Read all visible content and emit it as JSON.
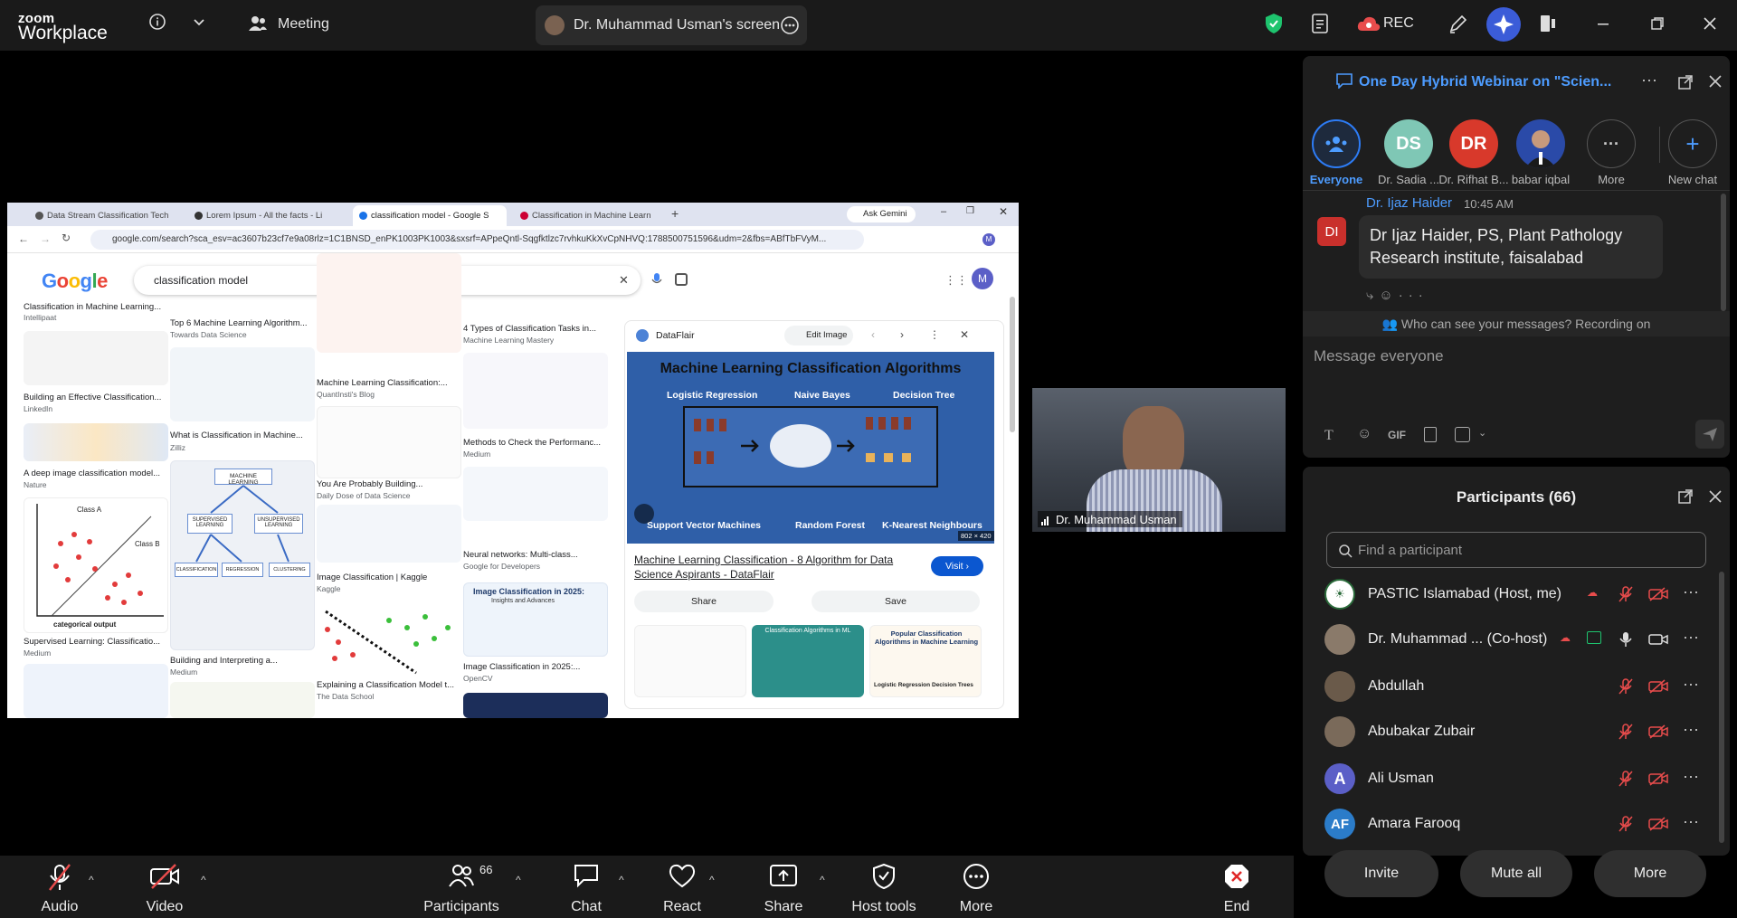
{
  "topbar": {
    "logo_line1": "zoom",
    "logo_line2": "Workplace",
    "meeting_label": "Meeting",
    "screen_label": "Dr. Muhammad Usman's screen",
    "rec_label": "REC"
  },
  "browser": {
    "tabs": [
      {
        "label": "Data Stream Classification Tech"
      },
      {
        "label": "Lorem Ipsum - All the facts - Li"
      },
      {
        "label": "classification model - Google S"
      },
      {
        "label": "Classification in Machine Learn"
      }
    ],
    "ask_gemini": "Ask Gemini",
    "url": "google.com/search?sca_esv=ac3607b23cf7e9a08rlz=1C1BNSD_enPK1003PK1003&sxsrf=APpeQntl-Sqgfktlzc7rvhkuKkXvCpNHVQ:1788500751596&udm=2&fbs=ABfTbFVyM...",
    "search_logo": "Google",
    "search_query": "classification model",
    "avatar_letter": "M",
    "results": [
      {
        "caption": "Classification in Machine Learning...",
        "source": "Intellipaat"
      },
      {
        "caption": "Building an Effective Classification...",
        "source": "LinkedIn"
      },
      {
        "caption": "A deep image classification model...",
        "source": "Nature"
      },
      {
        "caption": "Supervised Learning: Classificatio...",
        "source": "Medium"
      },
      {
        "caption": "Top 6 Machine Learning Algorithm...",
        "source": "Towards Data Science"
      },
      {
        "caption": "What is Classification in Machine...",
        "source": "Zilliz"
      },
      {
        "caption": "Building and Interpreting a...",
        "source": "Medium"
      },
      {
        "caption": "Machine Learning Classification:...",
        "source": "QuantInsti's Blog"
      },
      {
        "caption": "You Are Probably Building...",
        "source": "Daily Dose of Data Science"
      },
      {
        "caption": "Image Classification | Kaggle",
        "source": "Kaggle"
      },
      {
        "caption": "Explaining a Classification Model t...",
        "source": "The Data School"
      },
      {
        "caption": "4 Types of Classification Tasks in...",
        "source": "Machine Learning Mastery"
      },
      {
        "caption": "Methods to Check the Performanc...",
        "source": "Medium"
      },
      {
        "caption": "Neural networks: Multi-class...",
        "source": "Google for Developers"
      },
      {
        "caption": "Image Classification in 2025:...",
        "source": "OpenCV"
      }
    ],
    "tile_texts": {
      "class_a": "Class A",
      "class_b": "Class B",
      "categorical_output": "categorical output",
      "machine_learning": "MACHINE LEARNING",
      "supervised": "SUPERVISED LEARNING",
      "unsupervised": "UNSUPERVISED LEARNING",
      "classification": "CLASSIFICATION",
      "regression": "REGRESSION",
      "clustering": "CLUSTERING",
      "img_class_2025": "Image Classification in 2025:",
      "insights": "Insights and Advances"
    },
    "preview": {
      "site": "DataFlair",
      "edit_image": "Edit Image",
      "image_title": "Machine Learning Classification Algorithms",
      "algos_top": [
        "Logistic Regression",
        "Naive Bayes",
        "Decision Tree"
      ],
      "algos_bottom": [
        "Support Vector Machines",
        "Random Forest",
        "K-Nearest Neighbours"
      ],
      "dims": "802 × 420",
      "link_title": "Machine Learning Classification - 8 Algorithm for Data Science Aspirants - DataFlair",
      "visit": "Visit",
      "share": "Share",
      "save": "Save",
      "thumb2_title": "Classification Algorithms in ML",
      "thumb3_title": "Popular Classification Algorithms in Machine Learning",
      "thumb3_a": "Logistic Regression",
      "thumb3_b": "Decision Trees"
    }
  },
  "video_tile": {
    "name": "Dr. Muhammad Usman"
  },
  "chat": {
    "title": "One Day Hybrid Webinar on \"Scien...",
    "chips": [
      {
        "label": "Everyone",
        "initials": ""
      },
      {
        "label": "Dr. Sadia ...",
        "initials": "DS",
        "color": "#7fc7b5"
      },
      {
        "label": "Dr. Rifhat B...",
        "initials": "DR",
        "color": "#d8392b"
      },
      {
        "label": "babar iqbal",
        "initials": ""
      },
      {
        "label": "More",
        "initials": ""
      },
      {
        "label": "New chat",
        "initials": ""
      }
    ],
    "message": {
      "sender": "Dr. Ijaz Haider",
      "time": "10:45 AM",
      "initials": "DI",
      "text": "Dr Ijaz Haider, PS, Plant Pathology Research institute, faisalabad"
    },
    "visibility": "Who can see your messages? Recording on",
    "input_placeholder": "Message everyone",
    "gif_label": "GIF"
  },
  "participants": {
    "title": "Participants (66)",
    "search_placeholder": "Find a participant",
    "list": [
      {
        "name": "PASTIC Islamabad",
        "role": "(Host, me)",
        "initials": "",
        "color": "#ffffff"
      },
      {
        "name": "Dr. Muhammad ...",
        "role": "(Co-host)",
        "initials": "",
        "color": "#8a7a6a"
      },
      {
        "name": "Abdullah",
        "role": "",
        "initials": "",
        "color": "#6a5a4a"
      },
      {
        "name": "Abubakar Zubair",
        "role": "",
        "initials": "",
        "color": "#7a6a5a"
      },
      {
        "name": "Ali Usman",
        "role": "",
        "initials": "A",
        "color": "#5b5fc7"
      },
      {
        "name": "Amara Farooq",
        "role": "",
        "initials": "AF",
        "color": "#2b7cc9"
      }
    ],
    "invite": "Invite",
    "mute_all": "Mute all",
    "more": "More"
  },
  "bottombar": {
    "audio": "Audio",
    "video": "Video",
    "participants": "Participants",
    "participant_count": "66",
    "chat": "Chat",
    "react": "React",
    "share": "Share",
    "host_tools": "Host tools",
    "more": "More",
    "end": "End"
  },
  "colors": {
    "accent": "#0e71eb",
    "end": "#e02828",
    "brand_zoom": "#0b5cff"
  }
}
